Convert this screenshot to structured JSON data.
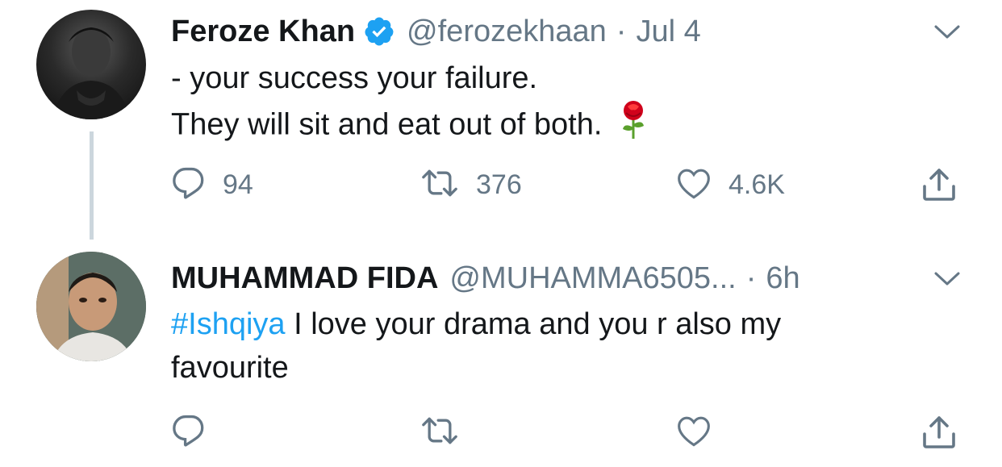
{
  "tweets": [
    {
      "name": "Feroze Khan",
      "verified": true,
      "handle": "@ferozekhaan",
      "separator": "·",
      "time": "Jul 4",
      "lines": [
        "- your success your failure.",
        "They will sit and eat out of both."
      ],
      "emoji": "rose",
      "counts": {
        "replies": "94",
        "retweets": "376",
        "likes": "4.6K"
      }
    },
    {
      "name": "MUHAMMAD FIDA",
      "handle": "@MUHAMMA6505...",
      "separator": "·",
      "time": "6h",
      "hashtag": "#Ishqiya",
      "text_after_hashtag": " I love your drama and you r also my favourite"
    }
  ],
  "colors": {
    "accent": "#1da1f2",
    "muted": "#657786",
    "thread_line": "#ccd6dd"
  }
}
